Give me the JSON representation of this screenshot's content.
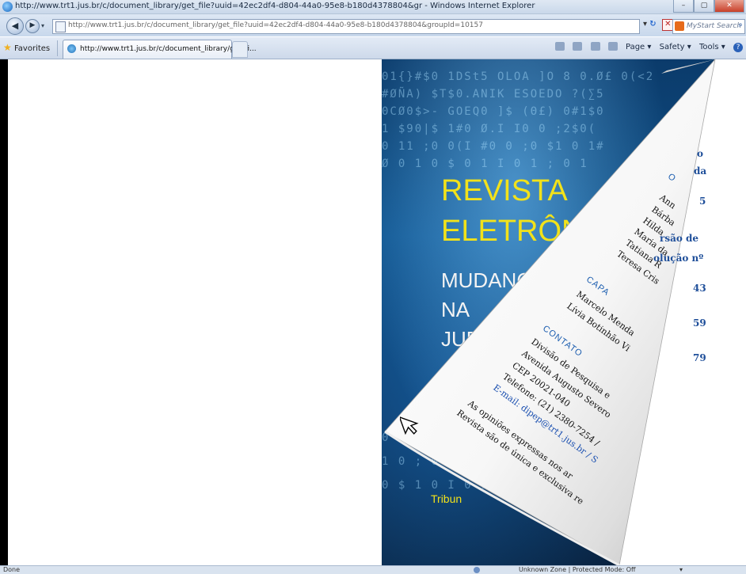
{
  "window": {
    "title": "http://www.trt1.jus.br/c/document_library/get_file?uuid=42ec2df4-d804-44a0-95e8-b180d4378804&gr - Windows Internet Explorer",
    "controls": [
      "–",
      "▢",
      "✕"
    ]
  },
  "address_bar": {
    "url": "http://www.trt1.jus.br/c/document_library/get_file?uuid=42ec2df4-d804-44a0-95e8-b180d4378804&groupId=10157",
    "search_placeholder": "MyStart Search"
  },
  "favorites_bar": {
    "favorites_label": "Favorites",
    "tab_label": "http://www.trt1.jus.br/c/document_library/get_fi...",
    "commands": [
      "Page ▾",
      "Safety ▾",
      "Tools ▾"
    ]
  },
  "cover": {
    "title_line1": "REVISTA",
    "title_line2": "ELETRÔN",
    "subtitle_line1": "MUDANÇ",
    "subtitle_line2": "NA",
    "subtitle_line3": "JUR",
    "footer": "Tribun"
  },
  "toc_right": {
    "items": [
      "o",
      "da",
      "5",
      "rsão de",
      "olução nº",
      "43",
      "59",
      "79"
    ]
  },
  "peel_page": {
    "partial_heading": "O",
    "names": [
      "Ann",
      "Bárba",
      "Hilda",
      "Maria da",
      "Tatiana R",
      "Teresa Cris"
    ],
    "capa_heading": "CAPA",
    "capa_lines": [
      "Marcelo Menda",
      "Lívia Botinhão Vi"
    ],
    "contato_heading": "CONTATO",
    "contato_lines": [
      "Divisão de Pesquisa e",
      "Avenida Augusto Severo",
      "CEP 20021-040",
      "Telefone: (21) 2380-7254 /",
      "E-mail: dipep@trt1.jus.br / S"
    ],
    "notice_lines": [
      "As opiniões expressas nos ar",
      "Revista são de única e exclusiva re"
    ]
  },
  "status_bar": {
    "left": "Done",
    "zone": "Unknown Zone | Protected Mode: Off",
    "zoom": "▾"
  },
  "colors": {
    "cover_title": "#f2e21a",
    "link": "#1a4fb0",
    "toc": "#1f4f9a"
  }
}
